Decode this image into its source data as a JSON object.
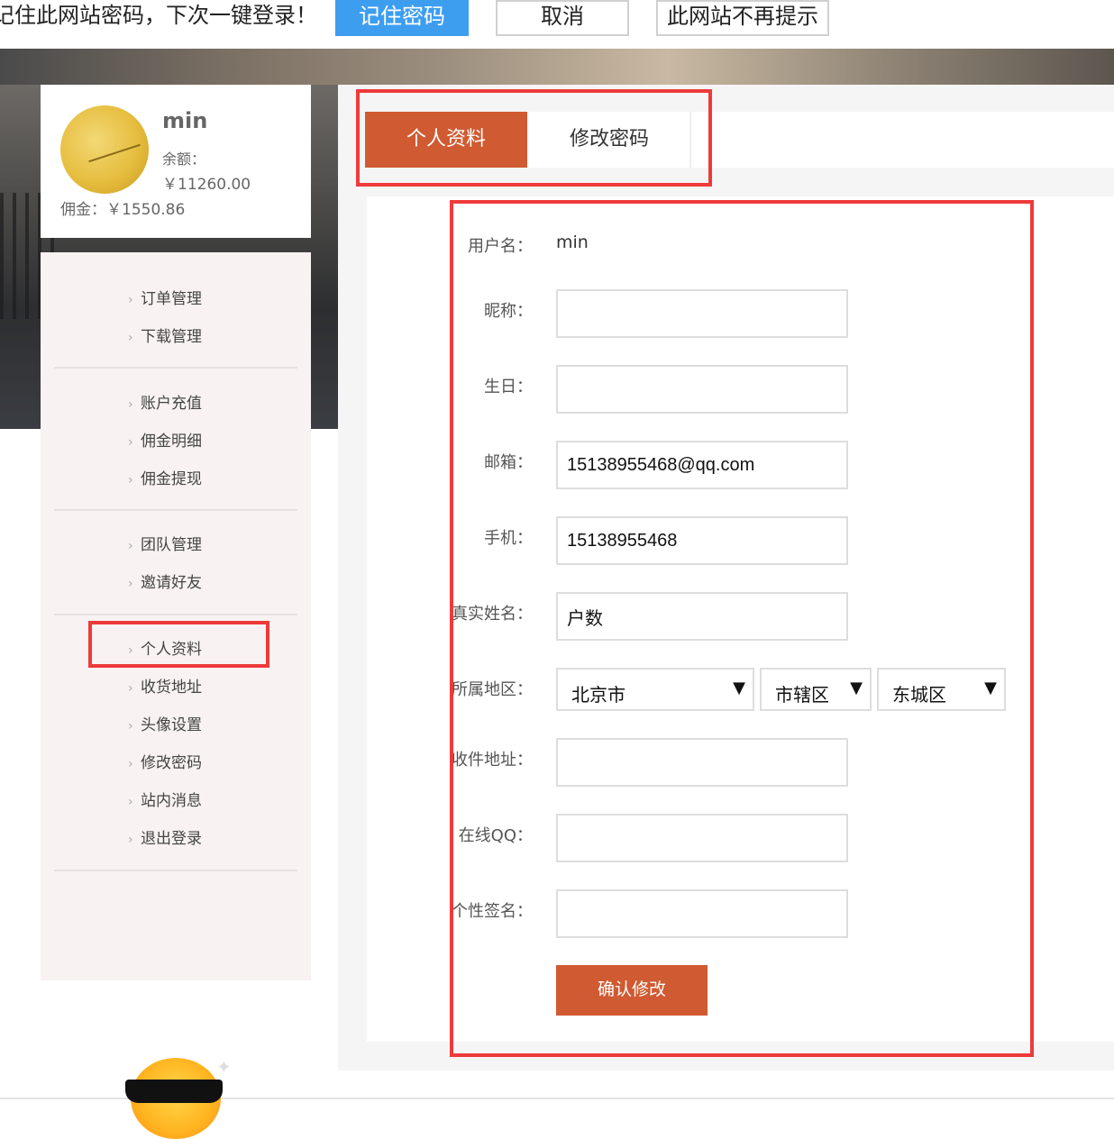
{
  "password_bar": {
    "message": "记住此网站密码，下次一键登录！",
    "remember_label": "记住密码",
    "cancel_label": "取消",
    "never_label": "此网站不再提示",
    "remember_color": "#3d9ef0"
  },
  "user": {
    "name": "min",
    "balance_label": "余额：",
    "balance": "￥11260.00",
    "commission": "佣金：￥1550.86"
  },
  "sidebar": {
    "groups": [
      [
        "订单管理",
        "下载管理"
      ],
      [
        "账户充值",
        "佣金明细",
        "佣金提现"
      ],
      [
        "团队管理",
        "邀请好友"
      ],
      [
        "个人资料",
        "收货地址",
        "头像设置",
        "修改密码",
        "站内消息",
        "退出登录"
      ]
    ],
    "active": "个人资料"
  },
  "tabs": {
    "profile": "个人资料",
    "change_password": "修改密码",
    "active_color": "#d05a31"
  },
  "form": {
    "username_label": "用户名：",
    "username_value": "min",
    "nickname_label": "昵称：",
    "nickname_value": "",
    "birthday_label": "生日：",
    "birthday_value": "",
    "email_label": "邮箱：",
    "email_value": "15138955468@qq.com",
    "phone_label": "手机：",
    "phone_value": "15138955468",
    "realname_label": "真实姓名：",
    "realname_value": "户数",
    "region_label": "所属地区：",
    "province": "北京市",
    "city": "市辖区",
    "district": "东城区",
    "address_label": "收件地址：",
    "address_value": "",
    "qq_label": "在线QQ：",
    "qq_value": "",
    "signature_label": "个性签名：",
    "signature_value": "",
    "submit_label": "确认修改"
  },
  "highlight_color": "#ee3a3a",
  "icons": {
    "menu_chevron": "chevron-right-icon",
    "select_arrow": "triangle-down-icon",
    "mascot": "sun-sunglasses-icon"
  }
}
